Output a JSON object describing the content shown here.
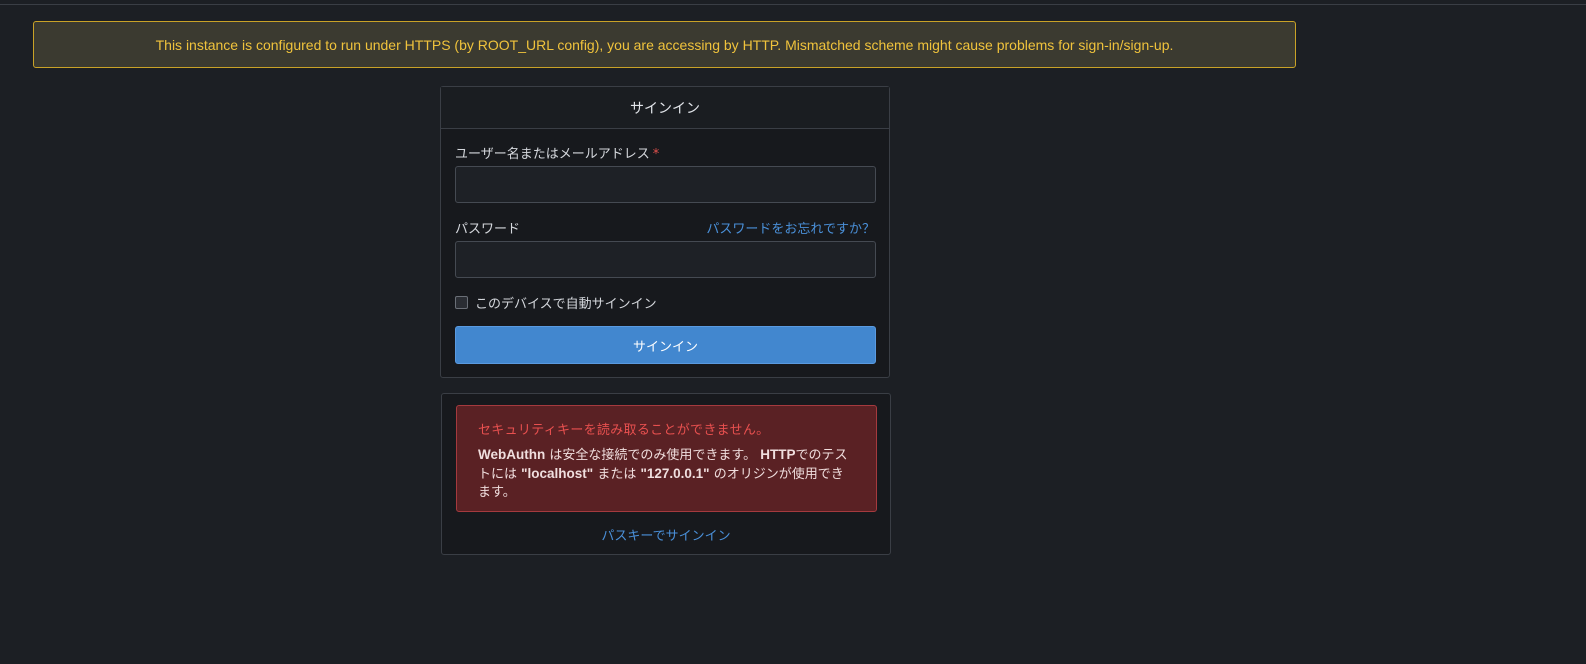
{
  "banner": {
    "text": "This instance is configured to run under HTTPS (by ROOT_URL config), you are accessing by HTTP. Mismatched scheme might cause problems for sign-in/sign-up."
  },
  "signin": {
    "header": "サインイン",
    "username_label": "ユーザー名またはメールアドレス",
    "required_mark": "*",
    "username_value": "",
    "password_label": "パスワード",
    "forgot_link": "パスワードをお忘れですか？",
    "password_value": "",
    "remember_label": "このデバイスで自動サインイン",
    "remember_checked": false,
    "submit_label": "サインイン"
  },
  "passkey": {
    "error_title": "セキュリティキーを読み取ることができません。",
    "error_body": {
      "webauthn": "WebAuthn",
      "part1": " は安全な接続でのみ使用できます。 ",
      "http": "HTTP",
      "part2": "でのテストには ",
      "localhost": "\"localhost\"",
      "part3": " または ",
      "ip": "\"127.0.0.1\"",
      "part4": " のオリジンが使用できます。"
    },
    "link_label": "パスキーでサインイン"
  },
  "colors": {
    "background": "#1c1f24",
    "banner_text": "#f0c33c",
    "banner_border": "#c9a227",
    "primary": "#4287cf",
    "link": "#4a90d9",
    "error_bg": "#5a2124",
    "error_text": "#e8504f"
  }
}
